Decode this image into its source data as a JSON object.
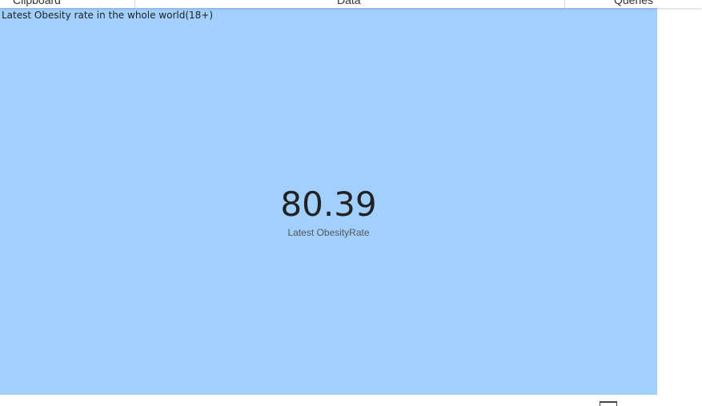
{
  "ribbon": {
    "groups": [
      "Clipboard",
      "Data",
      "Queries"
    ]
  },
  "card": {
    "title": "Latest Obesity rate in the whole world(18+)",
    "value": "80.39",
    "label": "Latest ObesityRate",
    "background_color": "#a2d0fe"
  },
  "footer": {
    "icon": "view-toggle-icon"
  }
}
